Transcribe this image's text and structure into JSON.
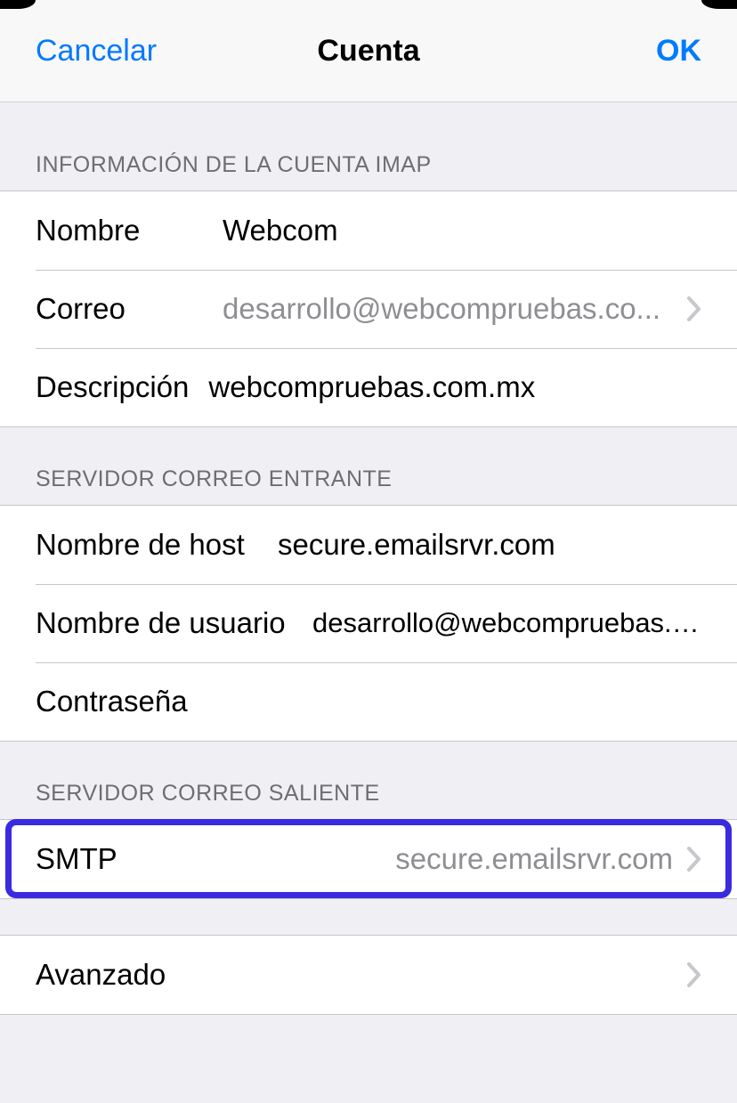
{
  "nav": {
    "cancel": "Cancelar",
    "title": "Cuenta",
    "ok": "OK"
  },
  "sections": {
    "imap_header": "INFORMACIÓN DE LA CUENTA IMAP",
    "incoming_header": "SERVIDOR CORREO ENTRANTE",
    "outgoing_header": "SERVIDOR CORREO SALIENTE"
  },
  "imap": {
    "name_label": "Nombre",
    "name_value": "Webcom",
    "email_label": "Correo",
    "email_value": "desarrollo@webcompruebas.co...",
    "desc_label": "Descripción",
    "desc_value": "webcompruebas.com.mx"
  },
  "incoming": {
    "host_label": "Nombre de host",
    "host_value": "secure.emailsrvr.com",
    "user_label": "Nombre de usuario",
    "user_value": "desarrollo@webcompruebas.co...",
    "pass_label": "Contraseña"
  },
  "outgoing": {
    "smtp_label": "SMTP",
    "smtp_value": "secure.emailsrvr.com"
  },
  "advanced": {
    "label": "Avanzado"
  }
}
